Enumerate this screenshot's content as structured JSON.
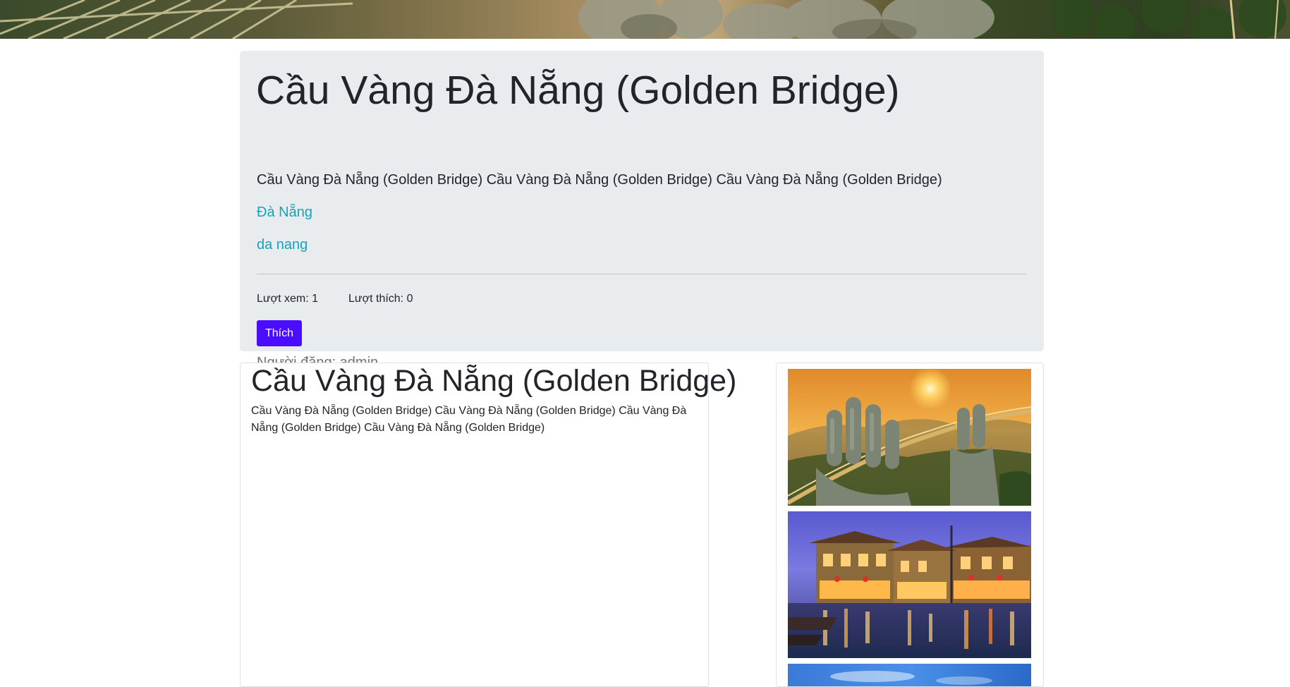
{
  "banner": {
    "image_name": "golden-bridge-hands-banner"
  },
  "jumbotron": {
    "title": "Cầu Vàng Đà Nẵng (Golden Bridge)",
    "lead": "Cầu Vàng Đà Nẵng (Golden Bridge) Cầu Vàng Đà Nẵng (Golden Bridge) Cầu Vàng Đà Nẵng (Golden Bridge)",
    "location_link": "Đà Nẵng",
    "tag_link": "da nang",
    "views_text": "Lượt xem: 1",
    "likes_text": "Lượt thích: 0",
    "like_button_label": "Thích",
    "poster_text": "Người đăng: admin"
  },
  "article": {
    "title": "Cầu Vàng Đà Nẵng (Golden Bridge)",
    "body": "Cầu Vàng Đà Nẵng (Golden Bridge) Cầu Vàng Đà Nẵng (Golden Bridge) Cầu Vàng Đà Nẵng (Golden Bridge) Cầu Vàng Đà Nẵng (Golden Bridge)"
  },
  "gallery": {
    "images": [
      {
        "name": "golden-bridge-sunset-image"
      },
      {
        "name": "hoi-an-night-river-image"
      },
      {
        "name": "blue-sky-image"
      }
    ]
  },
  "colors": {
    "jumbotron_bg": "#e9ecef",
    "link": "#17a2b8",
    "button": "#4a0dff",
    "muted": "#6c757d"
  }
}
